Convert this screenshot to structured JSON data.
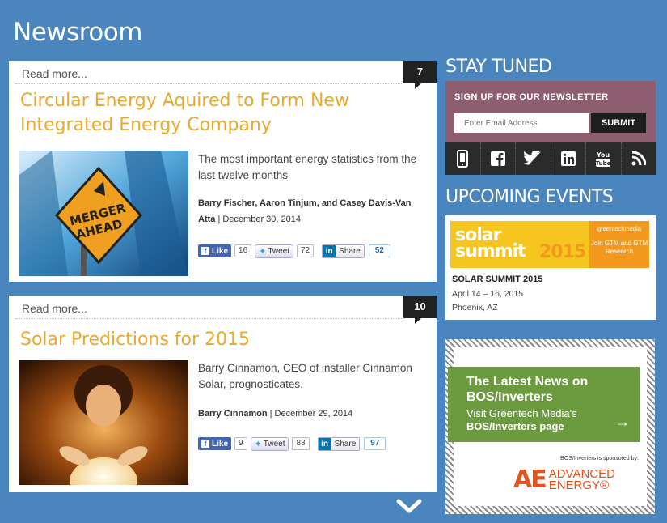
{
  "page": {
    "title": "Newsroom"
  },
  "articles": [
    {
      "read_more": "Read more...",
      "comment_count": "7",
      "headline": "Circular Energy Aquired to Form New Integrated Energy Company",
      "image_text": [
        "MERGER",
        "AHEAD"
      ],
      "summary": "The most important energy statistics from the last twelve months",
      "authors": "Barry Fischer, Aaron Tinjum, and Casey Davis-Van Atta",
      "date": "| December 30, 2014",
      "social": {
        "like_label": "Like",
        "like_count": "16",
        "tweet_label": "Tweet",
        "tweet_count": "72",
        "share_label": "Share",
        "share_count": "52"
      }
    },
    {
      "read_more": "Read more...",
      "comment_count": "10",
      "headline": "Solar Predictions for 2015",
      "summary": "Barry Cinnamon, CEO of installer Cinnamon Solar, prognosticates.",
      "authors": "Barry Cinnamon",
      "date": "| December 29, 2014",
      "social": {
        "like_label": "Like",
        "like_count": "9",
        "tweet_label": "Tweet",
        "tweet_count": "83",
        "share_label": "Share",
        "share_count": "97"
      }
    }
  ],
  "sidebar": {
    "stay_tuned": "STAY TUNED",
    "newsletter": {
      "label": "SIGN UP FOR OUR NEWSLETTER",
      "placeholder": "Enter Email Address",
      "submit": "SUBMIT"
    },
    "social_icons": [
      "mobile-icon",
      "facebook-icon",
      "twitter-icon",
      "linkedin-icon",
      "youtube-icon",
      "rss-icon"
    ],
    "events_heading": "UPCOMING EVENTS",
    "event": {
      "banner_word1": "solar",
      "banner_word2": "summit",
      "banner_year": "2015",
      "banner_brand": "greentechmedia",
      "banner_tagline": "Join GTM and GTM Research",
      "name": "SOLAR SUMMIT 2015",
      "date": "April 14 – 16, 2015",
      "location": "Phoenix, AZ"
    },
    "ad": {
      "line1": "The Latest News on",
      "line2": "BOS/Inverters",
      "line3": "Visit Greentech Media's",
      "line4": "BOS/Inverters page",
      "arrow": "→",
      "sponsor": "BOS/Inverters is sponsored by:",
      "logo_mark": "AE",
      "logo_line1": "ADVANCED",
      "logo_line2": "ENERGY®"
    }
  },
  "colors": {
    "background": "#4a86bd",
    "headline": "#e8a92c",
    "newsletter_bg": "#8d5d70",
    "ad_green": "#6b9a3f"
  }
}
